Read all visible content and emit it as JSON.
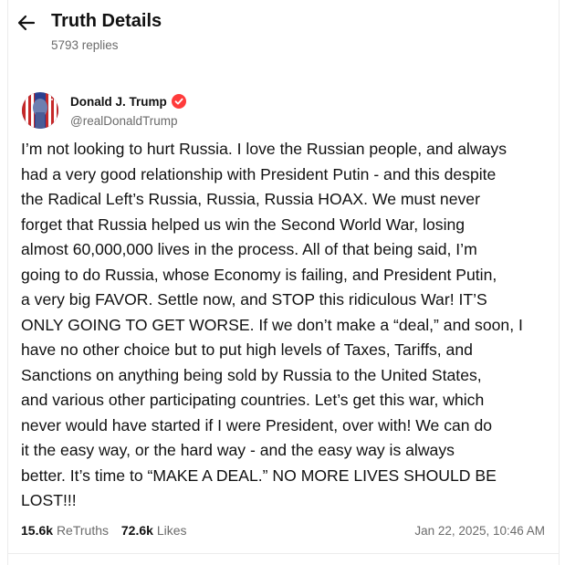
{
  "header": {
    "title": "Truth Details",
    "replies": "5793 replies"
  },
  "author": {
    "name": "Donald J. Trump",
    "handle": "@realDonaldTrump",
    "verified_color": "#ff3b3b"
  },
  "post": {
    "text": "I’m not looking to hurt Russia. I love the Russian people, and always\nhad a very good relationship with President Putin - and this despite\nthe Radical Left’s Russia, Russia, Russia HOAX. We must never\nforget that Russia helped us win the Second World War, losing\nalmost 60,000,000 lives in the process. All of that being said, I’m\ngoing to do Russia, whose Economy is failing, and President Putin,\na very big FAVOR. Settle now, and STOP this ridiculous War! IT’S\nONLY GOING TO GET WORSE. If we don’t make a “deal,” and soon, I\nhave no other choice but to put high levels of Taxes, Tariffs, and\nSanctions on anything being sold by Russia to the United States,\nand various other participating countries. Let’s get this war, which\nnever would have started if I were President, over with! We can do\nit the easy way, or the hard way - and the easy way is always\nbetter. It’s time to “MAKE A DEAL.” NO MORE LIVES SHOULD BE\nLOST!!!"
  },
  "stats": {
    "retruths_count": "15.6k",
    "retruths_label": "ReTruths",
    "likes_count": "72.6k",
    "likes_label": "Likes",
    "timestamp": "Jan 22, 2025, 10:46 AM"
  }
}
